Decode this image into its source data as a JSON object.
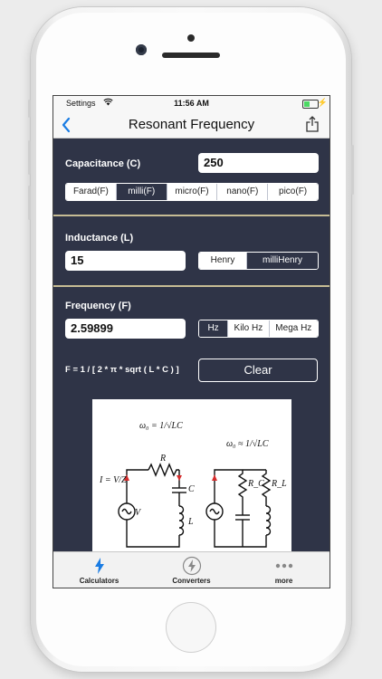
{
  "status": {
    "carrier": "Settings",
    "time": "11:56 AM"
  },
  "nav": {
    "title": "Resonant Frequency"
  },
  "capacitance": {
    "label": "Capacitance (C)",
    "value": "250",
    "units": [
      "Farad(F)",
      "milli(F)",
      "micro(F)",
      "nano(F)",
      "pico(F)"
    ],
    "selected": "milli(F)"
  },
  "inductance": {
    "label": "Inductance (L)",
    "value": "15",
    "units": [
      "Henry",
      "milliHenry"
    ],
    "selected": "milliHenry"
  },
  "frequency": {
    "label": "Frequency (F)",
    "value": "2.59899",
    "units": [
      "Hz",
      "Kilo Hz",
      "Mega Hz"
    ],
    "selected": "Hz"
  },
  "formula": "F = 1 / [ 2 * π * sqrt ( L * C ) ]",
  "clear_label": "Clear",
  "figure": {
    "left_eq": "ω₀ = 1/√LC",
    "right_eq": "ω₀ ≈ 1/√LC",
    "current_eq": "I = V/Z",
    "labels": {
      "R": "R",
      "C": "C",
      "L": "L",
      "V": "V",
      "RC": "R_C",
      "RL": "R_L"
    }
  },
  "tabs": [
    {
      "label": "Calculators",
      "icon": "bolt-icon",
      "active": true
    },
    {
      "label": "Converters",
      "icon": "bolt-circle-icon",
      "active": false
    },
    {
      "label": "more",
      "icon": "more-icon",
      "active": false
    }
  ],
  "colors": {
    "background": "#2f3447",
    "accent": "#1a7ce3",
    "divider": "#c6bc94"
  }
}
